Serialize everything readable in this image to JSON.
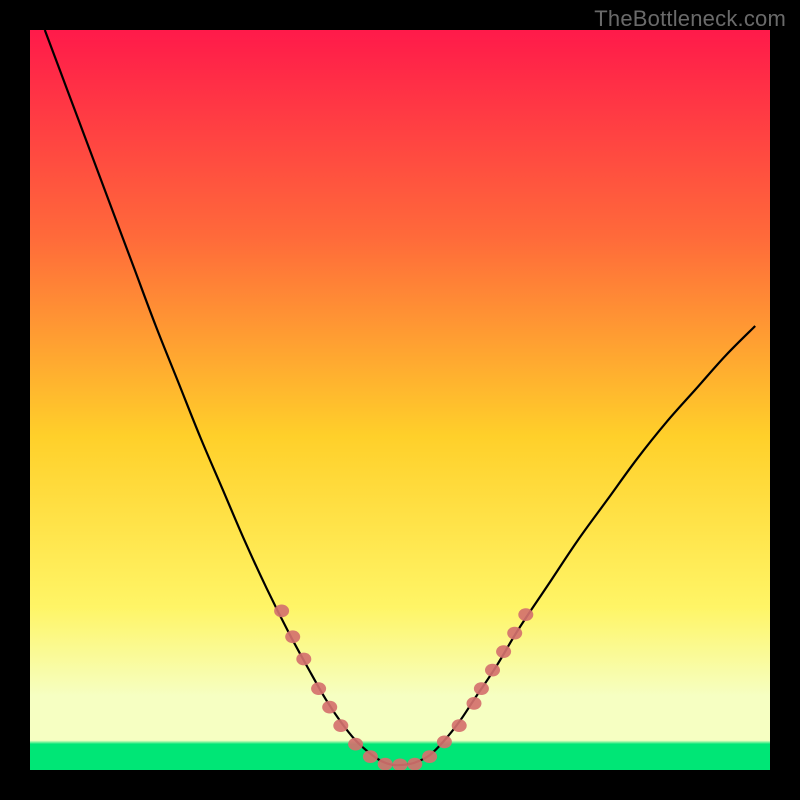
{
  "watermark": "TheBottleneck.com",
  "colors": {
    "frame": "#000000",
    "grad_top": "#ff1a4a",
    "grad_upper_mid": "#ff6a3a",
    "grad_mid": "#ffd02a",
    "grad_lower_mid": "#fff566",
    "grad_pale": "#f6ffc2",
    "grad_green": "#00e676",
    "curve": "#000000",
    "markers": "#d4716e"
  },
  "chart_data": {
    "type": "line",
    "title": "",
    "xlabel": "",
    "ylabel": "",
    "xlim": [
      0,
      100
    ],
    "ylim": [
      0,
      100
    ],
    "series": [
      {
        "name": "bottleneck-curve",
        "x": [
          2,
          5,
          8,
          11,
          14,
          17,
          20,
          23,
          26,
          29,
          32,
          35,
          38,
          40,
          42,
          44,
          46,
          47.5,
          49,
          50.5,
          52,
          54,
          56,
          58,
          60,
          63,
          66,
          70,
          74,
          78,
          82,
          86,
          90,
          94,
          98
        ],
        "y": [
          100,
          92,
          84,
          76,
          68,
          60,
          52.5,
          45,
          38,
          31,
          24.5,
          18.5,
          13,
          9.5,
          6.5,
          4,
          2.2,
          1.2,
          0.7,
          0.7,
          1.0,
          2.0,
          4.0,
          6.5,
          9.5,
          14,
          19,
          25,
          31,
          36.5,
          42,
          47,
          51.5,
          56,
          60
        ]
      }
    ],
    "markers": [
      {
        "x": 34.0,
        "y": 21.5
      },
      {
        "x": 35.5,
        "y": 18.0
      },
      {
        "x": 37.0,
        "y": 15.0
      },
      {
        "x": 39.0,
        "y": 11.0
      },
      {
        "x": 40.5,
        "y": 8.5
      },
      {
        "x": 42.0,
        "y": 6.0
      },
      {
        "x": 44.0,
        "y": 3.5
      },
      {
        "x": 46.0,
        "y": 1.8
      },
      {
        "x": 48.0,
        "y": 0.8
      },
      {
        "x": 50.0,
        "y": 0.7
      },
      {
        "x": 52.0,
        "y": 0.8
      },
      {
        "x": 54.0,
        "y": 1.8
      },
      {
        "x": 56.0,
        "y": 3.8
      },
      {
        "x": 58.0,
        "y": 6.0
      },
      {
        "x": 60.0,
        "y": 9.0
      },
      {
        "x": 61.0,
        "y": 11.0
      },
      {
        "x": 62.5,
        "y": 13.5
      },
      {
        "x": 64.0,
        "y": 16.0
      },
      {
        "x": 65.5,
        "y": 18.5
      },
      {
        "x": 67.0,
        "y": 21.0
      }
    ],
    "annotations": []
  }
}
